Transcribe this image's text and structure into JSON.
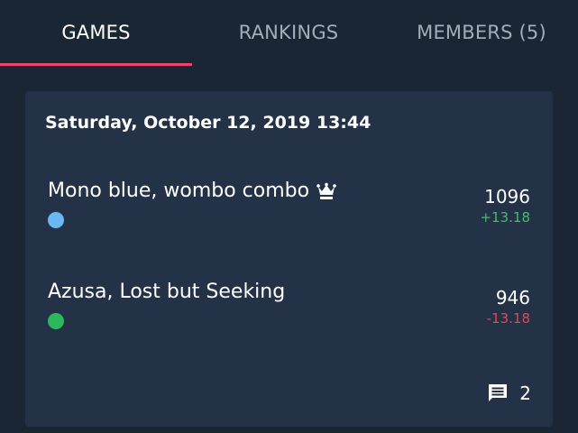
{
  "tabs": [
    {
      "label": "GAMES",
      "active": true
    },
    {
      "label": "RANKINGS",
      "active": false
    },
    {
      "label": "MEMBERS (5)",
      "active": false
    }
  ],
  "accent_color": "#f2426c",
  "game": {
    "date": "Saturday, October 12, 2019 13:44",
    "players": [
      {
        "name": "Mono blue, wombo combo",
        "winner_icon": "crown-icon",
        "color": "#6ab8f2",
        "score": "1096",
        "delta": "+13.18",
        "delta_color": "#3fbf6f"
      },
      {
        "name": "Azusa, Lost but Seeking",
        "color": "#2db85c",
        "score": "946",
        "delta": "-13.18",
        "delta_color": "#e0475a"
      }
    ],
    "comments": {
      "icon": "comment-icon",
      "count": "2"
    }
  }
}
